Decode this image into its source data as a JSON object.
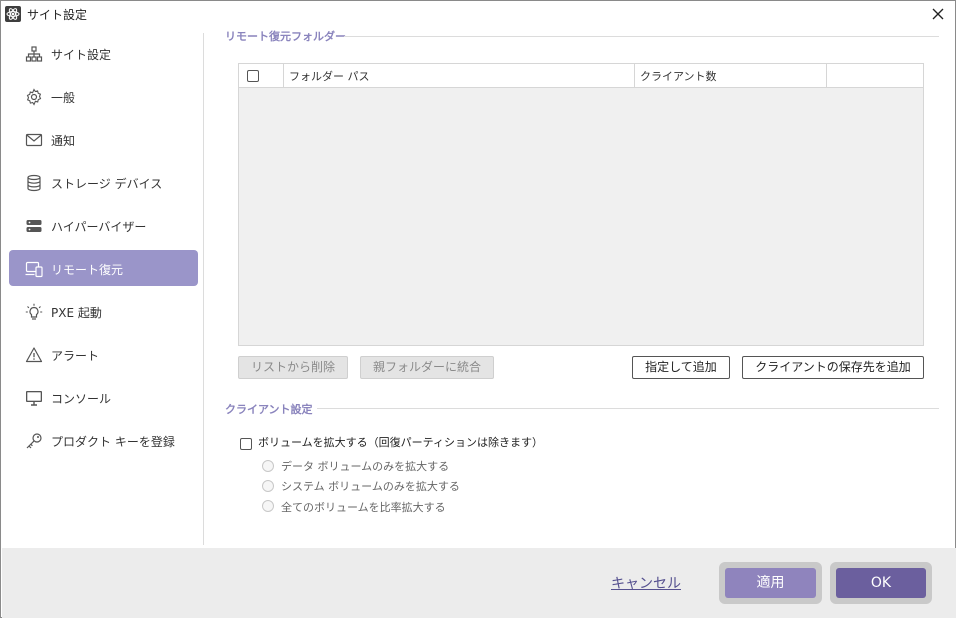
{
  "window": {
    "title": "サイト設定"
  },
  "sidebar": {
    "items": [
      {
        "label": "サイト設定",
        "icon": "sitemap-icon",
        "active": false
      },
      {
        "label": "一般",
        "icon": "gear-icon",
        "active": false
      },
      {
        "label": "通知",
        "icon": "envelope-icon",
        "active": false
      },
      {
        "label": "ストレージ デバイス",
        "icon": "database-icon",
        "active": false
      },
      {
        "label": "ハイパーバイザー",
        "icon": "server-icon",
        "active": false
      },
      {
        "label": "リモート復元",
        "icon": "remote-devices-icon",
        "active": true
      },
      {
        "label": "PXE 起動",
        "icon": "lightbulb-icon",
        "active": false
      },
      {
        "label": "アラート",
        "icon": "warning-icon",
        "active": false
      },
      {
        "label": "コンソール",
        "icon": "monitor-icon",
        "active": false
      },
      {
        "label": "プロダクト キーを登録",
        "icon": "key-icon",
        "active": false
      }
    ]
  },
  "main": {
    "remote_folder_section": {
      "title": "リモート復元フォルダー",
      "table": {
        "columns": [
          "フォルダー パス",
          "クライアント数",
          ""
        ],
        "rows": []
      },
      "buttons": {
        "remove_from_list": "リストから削除",
        "merge_to_parent": "親フォルダーに統合",
        "add_specified": "指定して追加",
        "add_client_destination": "クライアントの保存先を追加"
      }
    },
    "client_section": {
      "title": "クライアント設定",
      "expand_volume": {
        "label": "ボリュームを拡大する（回復パーティションは除きます）",
        "checked": false
      },
      "options": [
        "データ ボリュームのみを拡大する",
        "システム ボリュームのみを拡大する",
        "全てのボリュームを比率拡大する"
      ]
    }
  },
  "footer": {
    "cancel": "キャンセル",
    "apply": "適用",
    "ok": "OK"
  },
  "colors": {
    "accent": "#9a95c9",
    "accent_dark": "#6b5f9e",
    "apply_button": "#8f84bd",
    "section_title": "#8a84bd"
  }
}
